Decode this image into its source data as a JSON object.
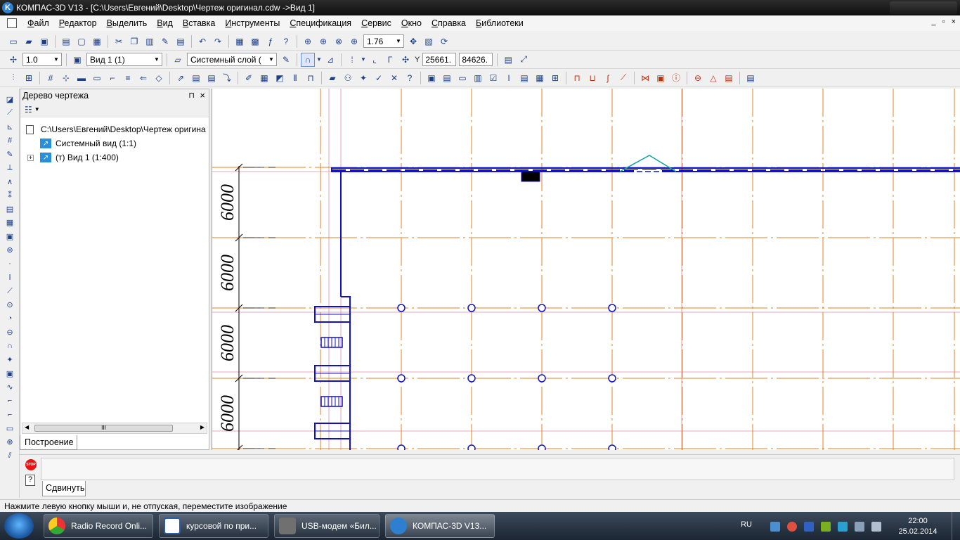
{
  "window": {
    "title": "КОМПАС-3D V13 - [C:\\Users\\Евгений\\Desktop\\Чертеж оригинал.cdw ->Вид 1]",
    "icon": "kompas-k-icon"
  },
  "menubar": {
    "items": [
      "Файл",
      "Редактор",
      "Выделить",
      "Вид",
      "Вставка",
      "Инструменты",
      "Спецификация",
      "Сервис",
      "Окно",
      "Справка",
      "Библиотеки"
    ],
    "mdi_controls": [
      "_",
      "▫",
      "×"
    ]
  },
  "toolbar_standard": {
    "zoom_value": "1.76"
  },
  "toolbar_current_state": {
    "step_value": "1.0",
    "view_value": "Вид 1 (1)",
    "layer_value": "Системный слой (",
    "coord_x": "25661.",
    "coord_y": "84626."
  },
  "tree_panel": {
    "title": "Дерево чертежа",
    "pin": "⊓",
    "close": "×",
    "items": [
      {
        "label": "C:\\Users\\Евгений\\Desktop\\Чертеж оригина"
      },
      {
        "label": "Системный вид (1:1)"
      },
      {
        "label": "(т) Вид 1 (1:400)"
      }
    ],
    "scroll_grip": "III",
    "tab": "Построение"
  },
  "drawing": {
    "dimension_labels": [
      "6000",
      "6000",
      "6000",
      "6000"
    ],
    "colors": {
      "axis": "#e08020",
      "construction": "#d890a0",
      "wall": "#1010c8",
      "accent": "#10a0a0"
    }
  },
  "command_panel": {
    "stop_text": "STOP",
    "help_text": "?",
    "tab": "Сдвинуть"
  },
  "statusbar": {
    "message": "Нажмите левую кнопку мыши и, не отпуская, переместите изображение"
  },
  "taskbar": {
    "tasks": [
      {
        "label": "Radio Record Onli...",
        "icon": "chrome-icon",
        "color": "#e8b020"
      },
      {
        "label": "курсовой по при...",
        "icon": "word-icon",
        "color": "#2a5ca8"
      },
      {
        "label": "USB-модем «Бил...",
        "icon": "modem-icon",
        "color": "#707070"
      },
      {
        "label": "КОМПАС-3D V13...",
        "icon": "kompas-icon",
        "color": "#2f7fd0"
      }
    ],
    "lang": "RU",
    "time": "22:00",
    "date": "25.02.2014"
  }
}
